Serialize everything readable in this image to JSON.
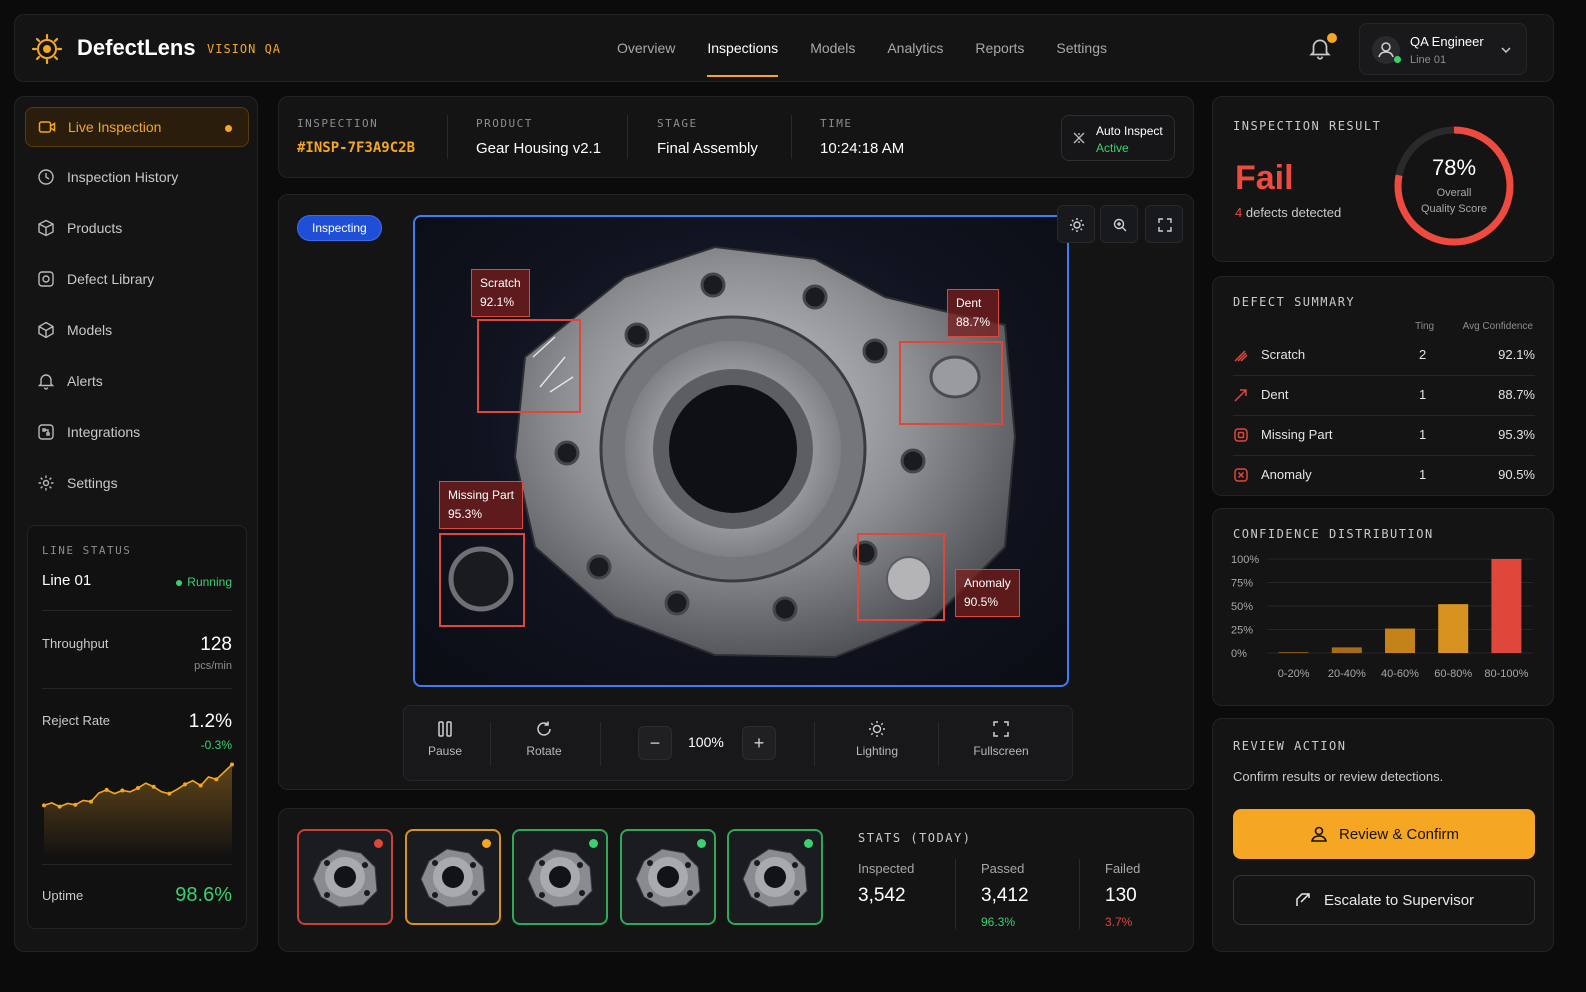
{
  "brand": {
    "name": "DefectLens",
    "sub": "VISION QA"
  },
  "nav": [
    {
      "label": "Overview",
      "active": false
    },
    {
      "label": "Inspections",
      "active": true
    },
    {
      "label": "Models",
      "active": false
    },
    {
      "label": "Analytics",
      "active": false
    },
    {
      "label": "Reports",
      "active": false
    },
    {
      "label": "Settings",
      "active": false
    }
  ],
  "user": {
    "name": "QA Engineer",
    "line": "Line 01"
  },
  "sidebar": {
    "items": [
      {
        "label": "Live Inspection",
        "icon": "video-icon"
      },
      {
        "label": "Inspection History",
        "icon": "history-icon"
      },
      {
        "label": "Products",
        "icon": "box-icon"
      },
      {
        "label": "Defect Library",
        "icon": "defect-library-icon"
      },
      {
        "label": "Models",
        "icon": "cube-icon"
      },
      {
        "label": "Alerts",
        "icon": "bell-icon"
      },
      {
        "label": "Integrations",
        "icon": "integrations-icon"
      },
      {
        "label": "Settings",
        "icon": "gear-icon"
      }
    ]
  },
  "line_status": {
    "caption": "LINE STATUS",
    "line": "Line 01",
    "state": "Running",
    "throughput_label": "Throughput",
    "throughput_value": "128",
    "throughput_unit": "pcs/min",
    "reject_label": "Reject Rate",
    "reject_value": "1.2%",
    "reject_delta": "-0.3%",
    "uptime_label": "Uptime",
    "uptime_value": "98.6%",
    "sparkline": [
      0.3,
      0.34,
      0.28,
      0.33,
      0.31,
      0.38,
      0.36,
      0.5,
      0.55,
      0.49,
      0.54,
      0.52,
      0.58,
      0.66,
      0.6,
      0.52,
      0.49,
      0.56,
      0.64,
      0.7,
      0.62,
      0.76,
      0.72,
      0.84,
      0.96
    ]
  },
  "inspection": {
    "cap_id": "INSPECTION",
    "id": "#INSP-7F3A9C2B",
    "cap_product": "PRODUCT",
    "product": "Gear Housing v2.1",
    "cap_stage": "STAGE",
    "stage": "Final Assembly",
    "cap_time": "TIME",
    "time": "10:24:18 AM",
    "auto_label": "Auto Inspect",
    "auto_state": "Active"
  },
  "viewer": {
    "badge": "Inspecting",
    "detections": [
      {
        "label": "Scratch",
        "conf": "92.1%"
      },
      {
        "label": "Dent",
        "conf": "88.7%"
      },
      {
        "label": "Missing Part",
        "conf": "95.3%"
      },
      {
        "label": "Anomaly",
        "conf": "90.5%"
      }
    ],
    "controls": {
      "pause": "Pause",
      "rotate": "Rotate",
      "zoom": "100%",
      "lighting": "Lighting",
      "fullscreen": "Fullscreen"
    }
  },
  "thumbnails": [
    {
      "status_color": "#e0473b",
      "border": "#c8423a"
    },
    {
      "status_color": "#f5a623",
      "border": "#d8921f"
    },
    {
      "status_color": "#3bd16f",
      "border": "#2fa85a"
    },
    {
      "status_color": "#3bd16f",
      "border": "#2fa85a"
    },
    {
      "status_color": "#3bd16f",
      "border": "#2fa85a"
    }
  ],
  "stats": {
    "caption": "STATS (TODAY)",
    "inspected_label": "Inspected",
    "inspected": "3,542",
    "passed_label": "Passed",
    "passed": "3,412",
    "passed_pct": "96.3%",
    "failed_label": "Failed",
    "failed": "130",
    "failed_pct": "3.7%"
  },
  "result": {
    "caption": "INSPECTION RESULT",
    "verdict": "Fail",
    "defects_count": "4",
    "defects_text": "defects detected",
    "score": "78%",
    "score_fraction": 0.78,
    "score_label_1": "Overall",
    "score_label_2": "Quality Score"
  },
  "summary": {
    "caption": "DEFECT SUMMARY",
    "col_count": "Ting",
    "col_conf": "Avg Confidence",
    "rows": [
      {
        "name": "Scratch",
        "count": "2",
        "conf": "92.1%"
      },
      {
        "name": "Dent",
        "count": "1",
        "conf": "88.7%"
      },
      {
        "name": "Missing Part",
        "count": "1",
        "conf": "95.3%"
      },
      {
        "name": "Anomaly",
        "count": "1",
        "conf": "90.5%"
      }
    ]
  },
  "distribution": {
    "caption": "CONFIDENCE DISTRIBUTION"
  },
  "chart_data": {
    "type": "bar",
    "title": "CONFIDENCE DISTRIBUTION",
    "categories": [
      "0-20%",
      "20-40%",
      "40-60%",
      "60-80%",
      "80-100%"
    ],
    "values": [
      1,
      6,
      26,
      52,
      100
    ],
    "ylim": [
      0,
      100
    ],
    "yticks": [
      "100%",
      "75%",
      "50%",
      "25%",
      "0%"
    ],
    "colors": [
      "#8a5a14",
      "#a86c14",
      "#c48218",
      "#d8921f",
      "#e0473b"
    ],
    "grid": true
  },
  "review": {
    "caption": "REVIEW ACTION",
    "text": "Confirm results or review detections.",
    "primary": "Review & Confirm",
    "secondary": "Escalate to Supervisor"
  }
}
